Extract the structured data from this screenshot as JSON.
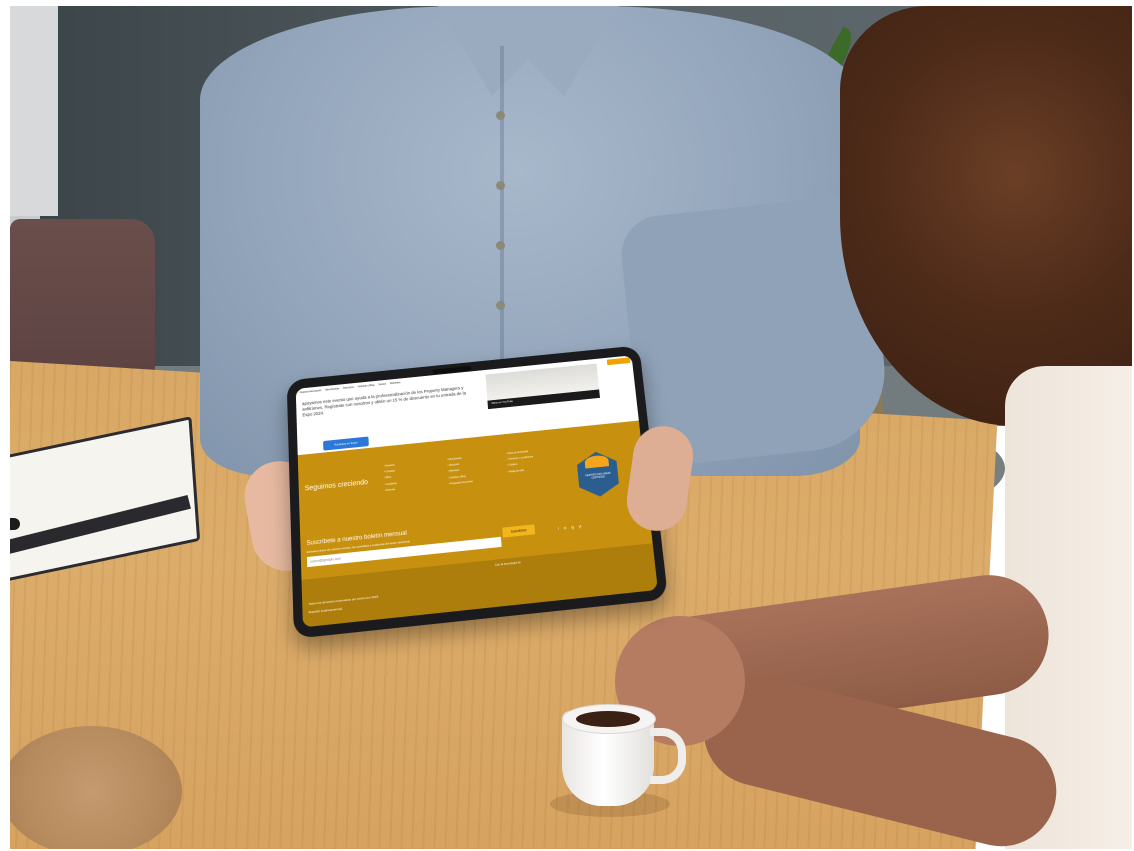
{
  "tablet": {
    "nav": [
      "Nuestra Asociación",
      "Membresías",
      "Directorio",
      "Noticias y Blog",
      "Socios",
      "Webinars"
    ],
    "event_text": "apoyamos este evento que ayuda a la profesionalización de los Property Managers y anfitriones. Regístrate con nosotros y obtén un 15 % de descuento en tu entrada de la Expo 2024.",
    "event_button": "Participa en Expo",
    "video_label": "Mirar en YouTube",
    "footer_title": "Seguimos creciendo",
    "links_col1": [
      "Nosotros",
      "Contacto",
      "Ética",
      "Academia",
      "Eventos"
    ],
    "links_col2": [
      "Membresías",
      "Directorio",
      "Webinars",
      "Noticias y Blog",
      "Preguntas frecuentes"
    ],
    "links_col3": [
      "Aviso de privacidad",
      "Términos y condiciones",
      "Cookies",
      "Mapa del sitio"
    ],
    "badge_text": "CERTIFICADO AMHR CERTIFIED",
    "newsletter_title": "Suscríbete a nuestro boletín mensual",
    "newsletter_desc": "Entérate primero de nuestros eventos, las novedades y tendencias del sector vacacional",
    "newsletter_placeholder": "correo@ejemplo.com",
    "newsletter_button": "Suscribirse",
    "social": [
      "f",
      "in",
      "ig",
      "yt"
    ],
    "powered_text": "Con la tecnología de",
    "copyright": "Todos los derechos reservados por amhr.com 2024",
    "lang": "Español (Latinoamérica)"
  },
  "colors": {
    "footer_gold": "#c7900f",
    "button_blue": "#2b78d8",
    "newsletter_button": "#f2b51b",
    "badge_blue": "#2b5d8e"
  }
}
